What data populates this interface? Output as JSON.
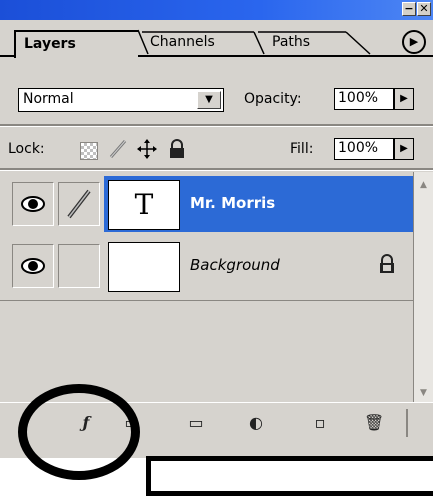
{
  "tabs": [
    {
      "label": "Layers",
      "active": true
    },
    {
      "label": "Channels",
      "active": false
    },
    {
      "label": "Paths",
      "active": false
    }
  ],
  "window_controls": {
    "minimize": "−",
    "close": "✕",
    "menu": "▶"
  },
  "blend": {
    "mode": "Normal",
    "opacity_label": "Opacity:",
    "opacity_value": "100%"
  },
  "lock": {
    "label": "Lock:",
    "fill_label": "Fill:",
    "fill_value": "100%"
  },
  "layers": [
    {
      "name": "Mr. Morris",
      "thumb": "T",
      "selected": true,
      "visible": true,
      "linked_brush": true
    },
    {
      "name": "Background",
      "thumb": "",
      "selected": false,
      "visible": true,
      "locked": true
    }
  ],
  "toolbar_icons": [
    "layer-style-icon",
    "mask-icon",
    "folder-icon",
    "adjustment-icon",
    "new-layer-icon",
    "trash-icon"
  ],
  "colors": {
    "selected": "#2c6ad6",
    "panel": "#d6d3ce",
    "titlebar": "#1b4fd8"
  }
}
